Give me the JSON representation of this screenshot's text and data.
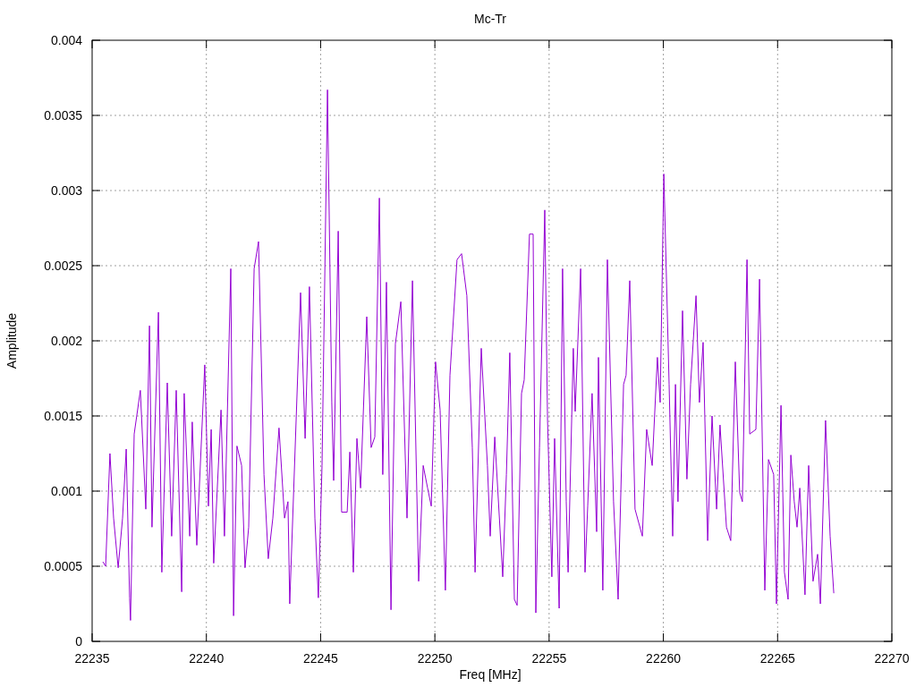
{
  "chart_data": {
    "type": "line",
    "title": "Mc-Tr",
    "xlabel": "Freq [MHz]",
    "ylabel": "Amplitude",
    "grid": true,
    "xlim": [
      22235,
      22270
    ],
    "ylim": [
      0,
      0.004
    ],
    "xticks": [
      22235,
      22240,
      22245,
      22250,
      22255,
      22260,
      22265,
      22270
    ],
    "yticks": [
      0,
      0.0005,
      0.001,
      0.0015,
      0.002,
      0.0025,
      0.003,
      0.0035,
      0.004
    ],
    "x": [
      22235.47,
      22235.59,
      22235.78,
      22235.94,
      22236.14,
      22236.33,
      22236.49,
      22236.64,
      22236.68,
      22236.84,
      22237.11,
      22237.35,
      22237.51,
      22237.62,
      22237.9,
      22238.05,
      22238.29,
      22238.48,
      22238.68,
      22238.92,
      22239.03,
      22239.27,
      22239.38,
      22239.58,
      22239.93,
      22240.09,
      22240.21,
      22240.32,
      22240.64,
      22240.79,
      22241.07,
      22241.19,
      22241.34,
      22241.54,
      22241.69,
      22241.85,
      22242.09,
      22242.28,
      22242.52,
      22242.71,
      22242.91,
      22243.18,
      22243.42,
      22243.57,
      22243.65,
      22244.12,
      22244.32,
      22244.51,
      22244.75,
      22244.9,
      22245.06,
      22245.3,
      22245.49,
      22245.57,
      22245.77,
      22245.92,
      22246.16,
      22246.28,
      22246.43,
      22246.59,
      22246.75,
      22247.02,
      22247.21,
      22247.37,
      22247.57,
      22247.72,
      22247.88,
      22248.08,
      22248.27,
      22248.51,
      22248.78,
      22249.02,
      22249.29,
      22249.49,
      22249.68,
      22249.84,
      22250.03,
      22250.23,
      22250.46,
      22250.66,
      22250.97,
      22251.17,
      22251.4,
      22251.64,
      22251.76,
      22252.03,
      22252.3,
      22252.42,
      22252.62,
      22252.97,
      22253.13,
      22253.28,
      22253.48,
      22253.6,
      22253.79,
      22253.91,
      22254.14,
      22254.3,
      22254.42,
      22254.58,
      22254.81,
      22254.93,
      22255.12,
      22255.24,
      22255.44,
      22255.59,
      22255.75,
      22255.83,
      22256.06,
      22256.14,
      22256.38,
      22256.57,
      22256.69,
      22256.88,
      22257.08,
      22257.16,
      22257.35,
      22257.55,
      22257.82,
      22258.02,
      22258.26,
      22258.37,
      22258.53,
      22258.76,
      22259.08,
      22259.27,
      22259.51,
      22259.74,
      22259.86,
      22260.02,
      22260.25,
      22260.41,
      22260.53,
      22260.64,
      22260.84,
      22261.03,
      22261.19,
      22261.43,
      22261.58,
      22261.74,
      22261.94,
      22262.13,
      22262.33,
      22262.48,
      22262.76,
      22262.95,
      22263.15,
      22263.34,
      22263.46,
      22263.66,
      22263.78,
      22264.05,
      22264.21,
      22264.44,
      22264.6,
      22264.83,
      22264.95,
      22265.15,
      22265.3,
      22265.46,
      22265.58,
      22265.73,
      22265.85,
      22265.97,
      22266.2,
      22266.36,
      22266.55,
      22266.75,
      22266.87,
      22267.1,
      22267.3,
      22267.46
    ],
    "series": [
      {
        "color": "#9400d3",
        "values": [
          0.00053,
          0.0005,
          0.00125,
          0.00082,
          0.00049,
          0.00082,
          0.00128,
          0.00029,
          0.00014,
          0.00138,
          0.00167,
          0.00088,
          0.0021,
          0.00076,
          0.00219,
          0.00046,
          0.00172,
          0.0007,
          0.00167,
          0.00033,
          0.00165,
          0.0007,
          0.00146,
          0.00064,
          0.00184,
          0.0009,
          0.00141,
          0.00052,
          0.00154,
          0.0007,
          0.00248,
          0.00017,
          0.0013,
          0.00117,
          0.00049,
          0.00076,
          0.00248,
          0.00266,
          0.00111,
          0.00055,
          0.00082,
          0.00142,
          0.00082,
          0.00093,
          0.00025,
          0.00232,
          0.00135,
          0.00236,
          0.00082,
          0.00029,
          0.00117,
          0.00367,
          0.00159,
          0.00107,
          0.00273,
          0.00086,
          0.00086,
          0.00126,
          0.00046,
          0.00135,
          0.00102,
          0.00216,
          0.00129,
          0.00136,
          0.00295,
          0.00111,
          0.00239,
          0.00021,
          0.00198,
          0.00226,
          0.00082,
          0.0024,
          0.0004,
          0.00117,
          0.00102,
          0.0009,
          0.00186,
          0.00154,
          0.00034,
          0.00177,
          0.00254,
          0.00258,
          0.0023,
          0.00129,
          0.00046,
          0.00195,
          0.00117,
          0.0007,
          0.00136,
          0.00043,
          0.00111,
          0.00192,
          0.00028,
          0.00024,
          0.00165,
          0.00174,
          0.00271,
          0.00271,
          0.00019,
          0.00129,
          0.00287,
          0.00147,
          0.00043,
          0.00135,
          0.00022,
          0.00248,
          0.00093,
          0.00046,
          0.00195,
          0.00153,
          0.00248,
          0.00046,
          0.0009,
          0.00165,
          0.00073,
          0.00189,
          0.00034,
          0.00254,
          0.00093,
          0.00028,
          0.00171,
          0.00177,
          0.0024,
          0.00088,
          0.0007,
          0.00141,
          0.00117,
          0.00189,
          0.00159,
          0.00311,
          0.00171,
          0.0007,
          0.00171,
          0.00093,
          0.0022,
          0.00108,
          0.00171,
          0.0023,
          0.00159,
          0.00199,
          0.00067,
          0.0015,
          0.00088,
          0.00144,
          0.00076,
          0.00067,
          0.00186,
          0.00099,
          0.00093,
          0.00254,
          0.00138,
          0.00141,
          0.00241,
          0.00034,
          0.00121,
          0.00111,
          0.00025,
          0.00157,
          0.00046,
          0.00028,
          0.00124,
          0.00093,
          0.00076,
          0.00102,
          0.00031,
          0.00117,
          0.0004,
          0.00058,
          0.00025,
          0.00147,
          0.0007,
          0.00032
        ]
      }
    ]
  }
}
